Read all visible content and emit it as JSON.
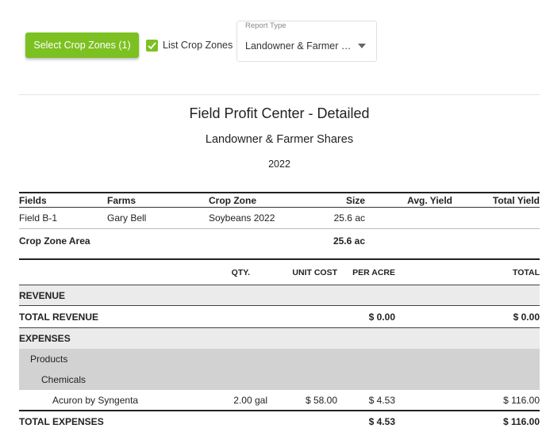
{
  "toolbar": {
    "select_button_label": "Select Crop Zones (1)",
    "list_checkbox_label": "List Crop Zones",
    "report_type_label": "Report Type",
    "report_type_value": "Landowner & Farmer Shares"
  },
  "report": {
    "title": "Field Profit Center - Detailed",
    "subtitle": "Landowner & Farmer Shares",
    "year": "2022"
  },
  "fields_table": {
    "headers": {
      "fields": "Fields",
      "farms": "Farms",
      "crop_zone": "Crop Zone",
      "size": "Size",
      "avg_yield": "Avg. Yield",
      "total_yield": "Total Yield"
    },
    "row": {
      "field": "Field B-1",
      "farm": "Gary Bell",
      "crop_zone": "Soybeans 2022",
      "size": "25.6 ac"
    },
    "area_label": "Crop Zone Area",
    "area_value": "25.6 ac"
  },
  "financials": {
    "headers": {
      "qty": "QTY.",
      "unit_cost": "UNIT COST",
      "per_acre": "PER ACRE",
      "total": "TOTAL"
    },
    "revenue_label": "REVENUE",
    "total_revenue_label": "TOTAL REVENUE",
    "total_revenue_per_acre": "$ 0.00",
    "total_revenue_total": "$ 0.00",
    "expenses_label": "EXPENSES",
    "products_label": "Products",
    "chemicals_label": "Chemicals",
    "item": {
      "name": "Acuron by Syngenta",
      "qty": "2.00 gal",
      "unit_cost": "$ 58.00",
      "per_acre": "$ 4.53",
      "total": "$ 116.00"
    },
    "total_expenses_label": "TOTAL EXPENSES",
    "total_expenses_per_acre": "$ 4.53",
    "total_expenses_total": "$ 116.00"
  },
  "colors": {
    "accent": "#7cc121",
    "band_light": "#ebebeb",
    "band_dark": "#d2d2d2"
  }
}
